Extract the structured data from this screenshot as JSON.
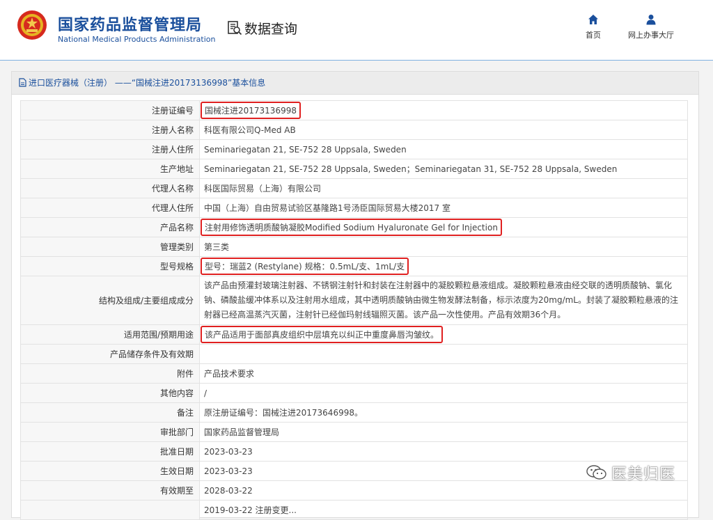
{
  "header": {
    "org_cn": "国家药品监督管理局",
    "org_en": "National Medical Products Administration",
    "query_label": "数据查询",
    "nav": [
      {
        "label": "首页",
        "icon": "home-icon"
      },
      {
        "label": "网上办事大厅",
        "icon": "user-icon"
      }
    ]
  },
  "panel": {
    "title": "进口医疗器械（注册） ——“国械注进20173136998”基本信息"
  },
  "rows": [
    {
      "label": "注册证编号",
      "value": "国械注进20173136998",
      "highlight": true
    },
    {
      "label": "注册人名称",
      "value": "科医有限公司Q-Med AB"
    },
    {
      "label": "注册人住所",
      "value": "Seminariegatan 21, SE-752 28 Uppsala, Sweden"
    },
    {
      "label": "生产地址",
      "value": "Seminariegatan 21, SE-752 28 Uppsala, Sweden；Seminariegatan 31, SE-752 28 Uppsala, Sweden"
    },
    {
      "label": "代理人名称",
      "value": "科医国际贸易（上海）有限公司"
    },
    {
      "label": "代理人住所",
      "value": "中国（上海）自由贸易试验区基隆路1号汤臣国际贸易大楼2017 室"
    },
    {
      "label": "产品名称",
      "value": "注射用修饰透明质酸钠凝胶Modified Sodium Hyaluronate Gel for Injection",
      "highlight": true
    },
    {
      "label": "管理类别",
      "value": "第三类"
    },
    {
      "label": "型号规格",
      "value": "型号：瑞蓝2 (Restylane) 规格：0.5mL/支、1mL/支",
      "highlight": true
    },
    {
      "label": "结构及组成/主要组成成分",
      "value": "该产品由预灌封玻璃注射器、不锈钢注射针和封装在注射器中的凝胶颗粒悬液组成。凝胶颗粒悬液由经交联的透明质酸钠、氯化钠、磷酸盐缓冲体系以及注射用水组成，其中透明质酸钠由微生物发酵法制备，标示浓度为20mg/mL。封装了凝胶颗粒悬液的注射器已经高温蒸汽灭菌，注射针已经伽玛射线辐照灭菌。该产品一次性使用。产品有效期36个月。",
      "multiline": true
    },
    {
      "label": "适用范围/预期用途",
      "value": "该产品适用于面部真皮组织中层填充以纠正中重度鼻唇沟皱纹。",
      "highlight": true
    },
    {
      "label": "产品储存条件及有效期",
      "value": ""
    },
    {
      "label": "附件",
      "value": "产品技术要求"
    },
    {
      "label": "其他内容",
      "value": "/"
    },
    {
      "label": "备注",
      "value": "原注册证编号：国械注进20173646998。"
    },
    {
      "label": "审批部门",
      "value": "国家药品监督管理局"
    },
    {
      "label": "批准日期",
      "value": "2023-03-23"
    },
    {
      "label": "生效日期",
      "value": "2023-03-23"
    },
    {
      "label": "有效期至",
      "value": "2028-03-22"
    },
    {
      "label": "",
      "value": "2019-03-22 注册变更..."
    }
  ],
  "watermark": {
    "text": "医美归医",
    "icon": "wechat-icon"
  },
  "colors": {
    "brand": "#1a4f9c",
    "highlight_box": "#e02020"
  }
}
